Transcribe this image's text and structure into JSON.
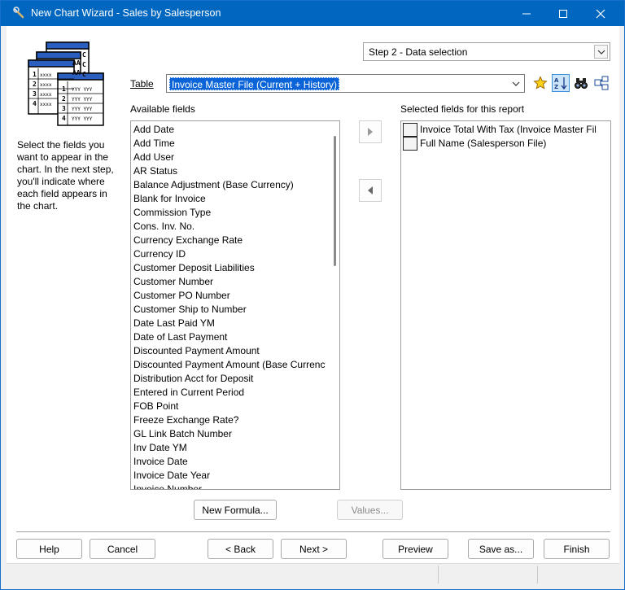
{
  "window": {
    "title": "New Chart Wizard - Sales by Salesperson"
  },
  "icons": {
    "app": "chart-wizard-wrench-icon",
    "minimize": "minimize-icon",
    "maximize": "maximize-icon",
    "close": "close-icon",
    "logo": "report-pages-icon",
    "favorites": "star-icon",
    "sort": "sort-a-z-icon",
    "find": "binoculars-icon",
    "relations": "table-relations-icon",
    "move_right": "arrow-right-icon",
    "move_left": "arrow-left-icon"
  },
  "step": {
    "selected": "Step 2 - Data selection"
  },
  "table": {
    "label": "Table",
    "value": "Invoice Master File (Current + History)"
  },
  "help_text": "Select the fields you want to appear in the chart. In the next step, you'll indicate where each field appears in the chart.",
  "available": {
    "label": "Available fields",
    "items": [
      "Add Date",
      "Add Time",
      "Add User",
      "AR Status",
      "Balance Adjustment (Base Currency)",
      "Blank for Invoice",
      "Commission Type",
      "Cons. Inv. No.",
      "Currency Exchange Rate",
      "Currency ID",
      "Customer Deposit Liabilities",
      "Customer Number",
      "Customer PO Number",
      "Customer Ship to Number",
      "Date Last Paid YM",
      "Date of Last Payment",
      "Discounted Payment Amount",
      "Discounted Payment Amount (Base Currency)",
      "Distribution Acct for Deposit",
      "Entered in Current Period",
      "FOB Point",
      "Freeze Exchange Rate?",
      "GL Link Batch Number",
      "Inv Date YM",
      "Invoice Date",
      "Invoice Date Year",
      "Invoice Number"
    ]
  },
  "selected": {
    "label": "Selected fields for this report",
    "items": [
      "Invoice Total With Tax (Invoice Master File)",
      "Full Name (Salesperson File)"
    ]
  },
  "buttons": {
    "new_formula": "New Formula...",
    "values": "Values...",
    "help": "Help",
    "cancel": "Cancel",
    "back": "< Back",
    "next": "Next >",
    "preview": "Preview",
    "save_as": "Save as...",
    "finish": "Finish"
  }
}
